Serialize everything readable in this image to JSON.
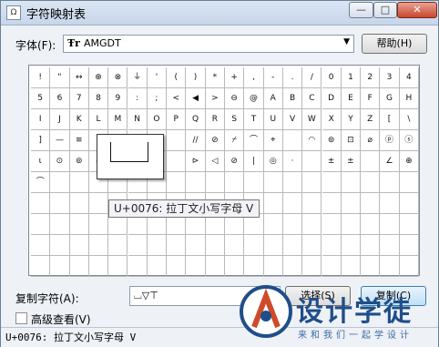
{
  "window": {
    "title": "字符映射表",
    "app_icon_glyph": "Ω",
    "minimize_glyph": "—",
    "maximize_glyph": "□",
    "close_glyph": "✕"
  },
  "font_picker": {
    "label": "字体(F):",
    "value": "AMGDT",
    "type_glyph": "Ŧr",
    "dropdown_glyph": "▼"
  },
  "help_button": "帮助(H)",
  "grid": {
    "rows": [
      [
        "!",
        "\"",
        "↔",
        "⊕",
        "⊗",
        "⏚",
        "'",
        "(",
        ")",
        "*",
        "+",
        ",",
        "-",
        ".",
        "/",
        "0",
        "1",
        "2",
        "3",
        "4"
      ],
      [
        "5",
        "6",
        "7",
        "8",
        "9",
        ":",
        ";",
        "<",
        "◀",
        ">",
        "⊖",
        "@",
        "A",
        "B",
        "C",
        "D",
        "E",
        "F",
        "G",
        "H"
      ],
      [
        "I",
        "J",
        "K",
        "L",
        "M",
        "N",
        "O",
        "P",
        "Q",
        "R",
        "S",
        "T",
        "U",
        "V",
        "W",
        "X",
        "Y",
        "Z",
        "[",
        "\\"
      ],
      [
        "]",
        "—",
        "≡",
        "",
        "",
        "",
        "",
        "",
        "//",
        "⊘",
        "⌿",
        "⌒",
        "⌖",
        "",
        "◠",
        "⊚",
        "⊡",
        "⌀",
        "ⓟ",
        "ⓢ"
      ],
      [
        "ɩ",
        "⊙",
        "⊚",
        "⌀",
        "",
        "",
        "",
        "",
        "⊳",
        "◁",
        "⊘",
        "|",
        "◎",
        "·",
        "",
        "±",
        "±",
        "",
        "∠",
        "⊕"
      ],
      [
        "⌒",
        "",
        "",
        "",
        "",
        "",
        "",
        "",
        "",
        "",
        "",
        "",
        "",
        "",
        "",
        "",
        "",
        "",
        "",
        ""
      ],
      [
        "",
        "",
        "",
        "",
        "",
        "",
        "",
        "",
        "",
        "",
        "",
        "",
        "",
        "",
        "",
        "",
        "",
        "",
        "",
        ""
      ],
      [
        "",
        "",
        "",
        "",
        "",
        "",
        "",
        "",
        "",
        "",
        "",
        "",
        "",
        "",
        "",
        "",
        "",
        "",
        "",
        ""
      ],
      [
        "",
        "",
        "",
        "",
        "",
        "",
        "",
        "",
        "",
        "",
        "",
        "",
        "",
        "",
        "",
        "",
        "",
        "",
        "",
        ""
      ],
      [
        "",
        "",
        "",
        "",
        "",
        "",
        "",
        "",
        "",
        "",
        "",
        "",
        "",
        "",
        "",
        "",
        "",
        "",
        "",
        ""
      ]
    ]
  },
  "tooltip": "U+0076: 拉丁文小写字母 V",
  "copy": {
    "label": "复制字符(A):",
    "value": "⌴▽⊤",
    "select_button": "选择(S)",
    "copy_button": "复制(C)"
  },
  "advanced": {
    "label": "高级查看(V)",
    "checked": false
  },
  "status": "U+0076: 拉丁文小写字母 V",
  "watermark": {
    "title": "设计学徒",
    "subtitle": "来和我们一起学设计"
  },
  "colors": {
    "accent": "#3c7fb1",
    "close": "#c8472e",
    "watermark": "#1f4e8a"
  }
}
